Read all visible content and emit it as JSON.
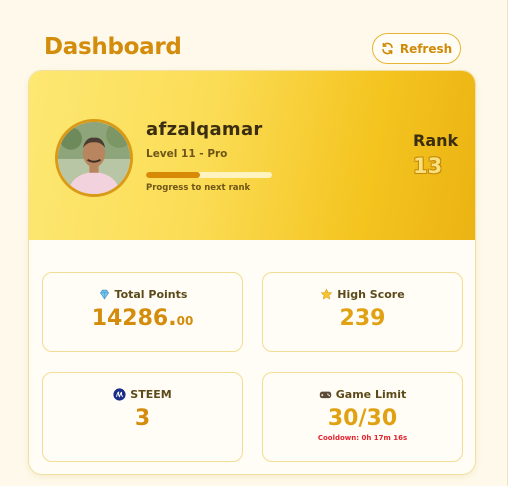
{
  "header": {
    "title": "Dashboard",
    "refresh_label": "Refresh"
  },
  "profile": {
    "username": "afzalqamar",
    "level": "Level 11 - Pro",
    "progress_fraction": 0.43,
    "progress_label": "Progress to next rank",
    "rank_label": "Rank",
    "rank_value": "13"
  },
  "stats": {
    "total_points": {
      "label": "Total Points",
      "value_int": "14286.",
      "value_dec": "00",
      "icon": "diamond-icon"
    },
    "high_score": {
      "label": "High Score",
      "value": "239",
      "icon": "star-icon"
    },
    "steem": {
      "label": "STEEM",
      "value": "3",
      "icon": "steem-logo-icon"
    },
    "game_limit": {
      "label": "Game Limit",
      "value": "30/30",
      "cooldown": "Cooldown: 0h 17m 16s",
      "icon": "gamepad-icon"
    }
  },
  "colors": {
    "accent": "#d38c0b",
    "gold": "#e0a113",
    "warning": "#e0242f"
  }
}
